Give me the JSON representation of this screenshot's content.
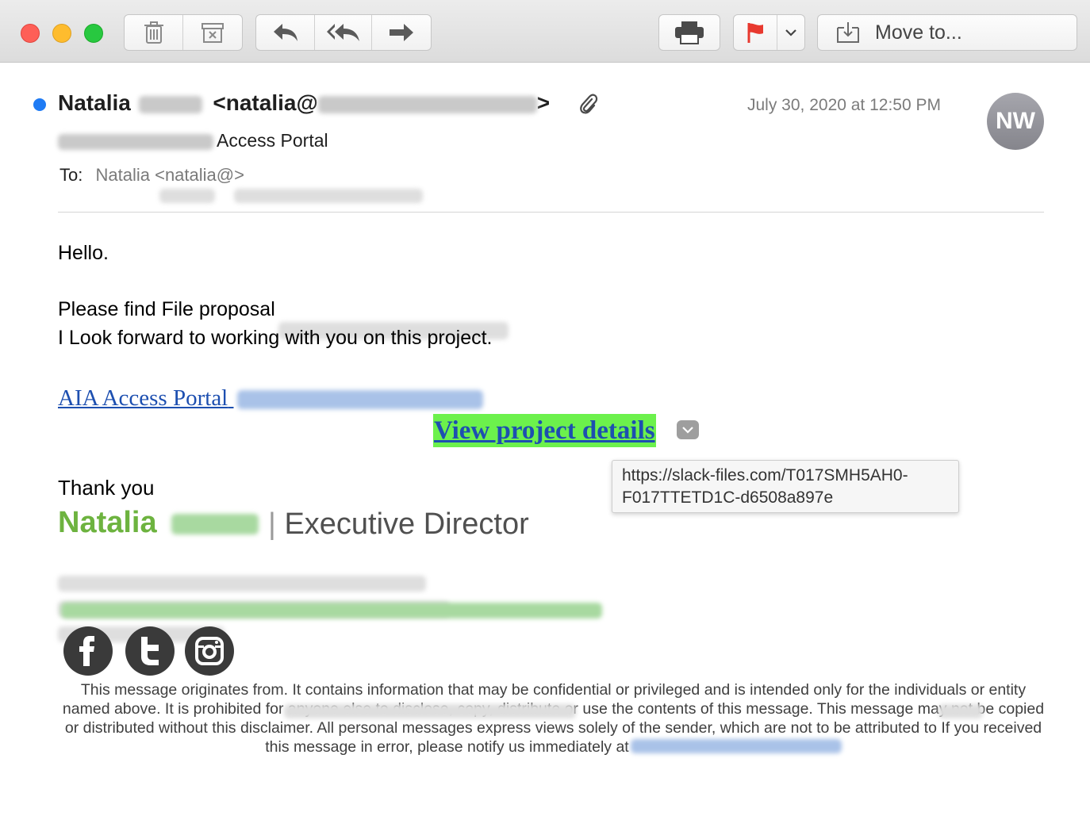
{
  "toolbar": {
    "icons": [
      "trash-icon",
      "archive-icon",
      "reply-icon",
      "reply-all-icon",
      "forward-icon",
      "print-icon",
      "flag-icon",
      "chevron-down-icon",
      "move-to-icon"
    ],
    "move_to_label": "Move to...",
    "flag_color": "#e8392f"
  },
  "header": {
    "sender_first_name": "Natalia",
    "sender_email_prefix": "<natalia@",
    "sender_email_suffix": ">",
    "date": "July 30, 2020 at 12:50 PM",
    "avatar_initials": "NW",
    "subject_visible": "Access Portal",
    "to_label": "To:",
    "to_first_name": "Natalia",
    "to_email_prefix": "<natalia@",
    "to_email_suffix": ">",
    "unread_color": "#1f7bf4"
  },
  "body": {
    "greeting": "Hello.",
    "line1": "Please find File proposal",
    "line2": "I Look forward to working with you on this project.",
    "portal_link": "AIA Access Portal",
    "view_details": "View project details",
    "link_url_line1": "https://slack-files.com/T017SMH5AH0-",
    "link_url_line2": "F017TTETD1C-d6508a897e",
    "highlight_color": "#6cf14c",
    "link_color": "#1d4fb0"
  },
  "signature": {
    "thank_you": "Thank you",
    "name": "Natalia",
    "separator": "|",
    "title": "Executive Director",
    "name_color": "#6db33f",
    "social_icons": [
      "facebook-icon",
      "twitter-icon",
      "instagram-icon"
    ]
  },
  "disclaimer": {
    "part1": "This message originates from",
    "part2": ".  It contains information that may be confidential or privileged and is intended only for the individuals or entity named above. It is prohibited for anyone else to disclose, copy, distribute or use the contents of this message. This message may not be copied or distributed without this disclaimer. All personal messages express views solely of the sender, which are not to be attributed to",
    "part3": " If you received this message in error, please notify us immediately at"
  }
}
